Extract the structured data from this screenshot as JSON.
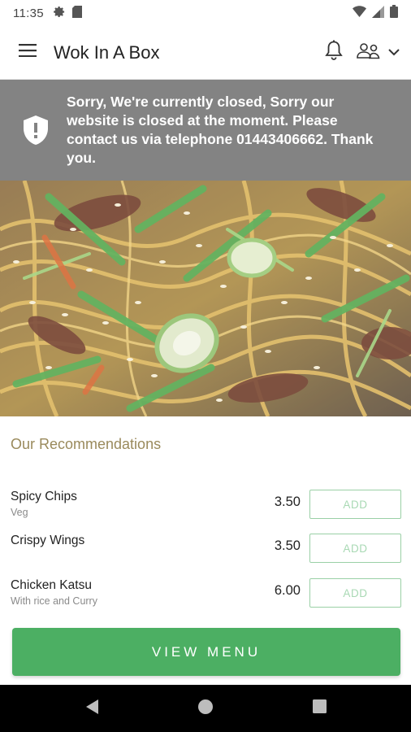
{
  "status_bar": {
    "time": "11:35",
    "icons": [
      "settings-icon",
      "sim-card-icon",
      "wifi-icon",
      "signal-icon",
      "battery-icon"
    ]
  },
  "app_bar": {
    "title": "Wok In A Box",
    "icons": [
      "menu-icon",
      "bell-icon",
      "account-icon",
      "chevron-down-icon"
    ]
  },
  "banner": {
    "icon": "shield-alert-icon",
    "message": "Sorry, We're currently closed, Sorry our website is closed at the moment. Please contact us via telephone 01443406662. Thank you."
  },
  "hero": {
    "image": "noodles-stir-fry-photo"
  },
  "recommendations": {
    "title": "Our Recommendations",
    "items": [
      {
        "name": "Spicy Chips",
        "description": "Veg",
        "price": "3.50",
        "action": "ADD"
      },
      {
        "name": "Crispy Wings",
        "description": "",
        "price": "3.50",
        "action": "ADD"
      },
      {
        "name": "Chicken Katsu",
        "description": "With rice and Curry",
        "price": "6.00",
        "action": "ADD"
      }
    ]
  },
  "view_menu_label": "VIEW MENU",
  "nav_bar": {
    "icons": [
      "back-icon",
      "home-icon",
      "recents-icon"
    ]
  },
  "colors": {
    "primary_green": "#4caf63",
    "add_border": "#9ad0a6",
    "banner_gray": "#838383",
    "section_title": "#9a8a5c"
  }
}
